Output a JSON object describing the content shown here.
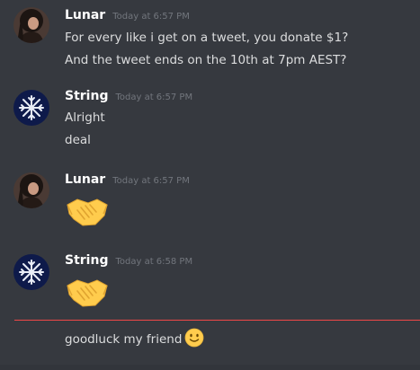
{
  "messages": [
    {
      "author": "Lunar",
      "time": "Today at 6:57 PM",
      "avatar": "dark-haired-person-avatar",
      "lines": [
        "For every like i get on a tweet, you donate $1?",
        "And the tweet ends on the 10th at 7pm AEST?"
      ]
    },
    {
      "author": "String",
      "time": "Today at 6:57 PM",
      "avatar": "snowflake-avatar",
      "lines": [
        "Alright",
        "deal"
      ]
    },
    {
      "author": "Lunar",
      "time": "Today at 6:57 PM",
      "avatar": "dark-haired-person-avatar",
      "emoji": "handshake-emoji"
    },
    {
      "author": "String",
      "time": "Today at 6:58 PM",
      "avatar": "snowflake-avatar",
      "emoji": "handshake-emoji"
    }
  ],
  "new_message": {
    "text": "goodluck my friend",
    "emoji": "slight-smile-emoji"
  },
  "colors": {
    "background": "#36393f",
    "username": "#ffffff",
    "timestamp": "#72767d",
    "text": "#dcddde",
    "new_message_divider": "#f04747",
    "emoji_yellow": "#ffcc4d"
  }
}
